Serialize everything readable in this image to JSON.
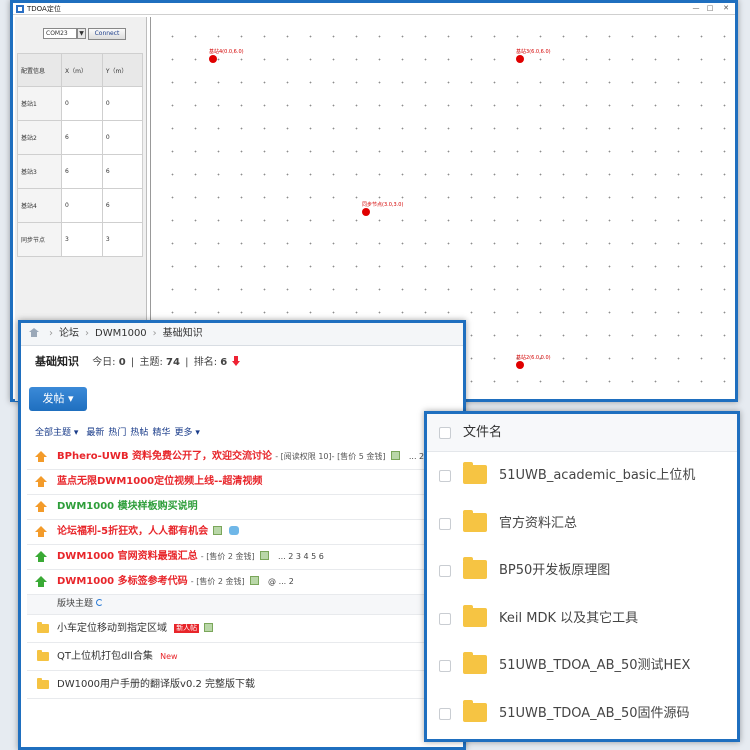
{
  "tdoa_window": {
    "title": "TDOA定位",
    "controls": {
      "min": "—",
      "max": "□",
      "close": "✕"
    },
    "com_port": "COM23",
    "com_arrow": "▼",
    "connect_label": "Connect",
    "table": {
      "headers": [
        "配置信息",
        "X（m）",
        "Y（m）"
      ],
      "rows": [
        [
          "基站1",
          "0",
          "0"
        ],
        [
          "基站2",
          "6",
          "0"
        ],
        [
          "基站3",
          "6",
          "6"
        ],
        [
          "基站4",
          "0",
          "6"
        ],
        [
          "同步节点",
          "3",
          "3"
        ]
      ]
    },
    "plot_nodes": [
      {
        "label": "基站4(0.0,6.0)"
      },
      {
        "label": "基站3(6.0,6.0)"
      },
      {
        "label": "同步节点(3.0,3.0)"
      },
      {
        "label": "基站2(6.0,0.0)"
      }
    ]
  },
  "forum": {
    "breadcrumb": [
      "论坛",
      "DWM1000",
      "基础知识"
    ],
    "title": "基础知识",
    "stats": {
      "today_label": "今日:",
      "today_value": "0",
      "topics_label": "主题:",
      "topics_value": "74",
      "rank_label": "排名:",
      "rank_value": "6"
    },
    "new_post_label": "发帖 ▾",
    "filters": [
      "全部主题 ▾",
      "最新",
      "热门",
      "热帖",
      "精华",
      "更多 ▾"
    ],
    "threads": [
      {
        "title": "BPhero-UWB 资料免费公开了，欢迎交流讨论",
        "meta": "- [阅读权限 10]- [售价 5 金钱]",
        "pager": "... 2"
      },
      {
        "title": "蓝点无限DWM1000定位视频上线--超清视频"
      },
      {
        "title": "DWM1000 模块样板购买说明"
      },
      {
        "title": "论坛福利-5折狂欢，人人都有机会"
      },
      {
        "title": "DWM1000 官网资料最强汇总",
        "meta": "- [售价 2 金钱]",
        "pager": "... 2 3 4 5 6"
      },
      {
        "title": "DWM1000 多标签参考代码",
        "meta": "- [售价 2 金钱]",
        "pager": "@ ... 2"
      }
    ],
    "section_label": "版块主题",
    "plain_threads": [
      {
        "title": "小车定位移动到指定区域",
        "badge": "新人帖"
      },
      {
        "title": "QT上位机打包dll合集",
        "badge": "New"
      },
      {
        "title": "DW1000用户手册的翻译版v0.2 完整版下载"
      }
    ]
  },
  "files": {
    "column_name": "文件名",
    "items": [
      "51UWB_academic_basic上位机",
      "官方资料汇总",
      "BP50开发板原理图",
      "Keil MDK 以及其它工具",
      "51UWB_TDOA_AB_50测试HEX",
      "51UWB_TDOA_AB_50固件源码"
    ]
  }
}
